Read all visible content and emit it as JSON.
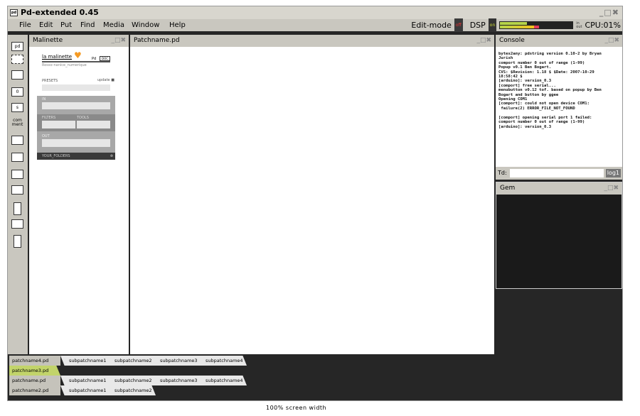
{
  "window": {
    "title": "Pd-extended 0.45",
    "app_icon": "pd-icon"
  },
  "menu": [
    "File",
    "Edit",
    "Put",
    "Find",
    "Media",
    "Window",
    "Help"
  ],
  "status": {
    "edit_mode_label": "Edit-mode",
    "edit_mode_state": "off",
    "dsp_label": "DSP",
    "dsp_state": "on",
    "meter_labels": [
      "in",
      "out"
    ],
    "cpu": "CPU:01%"
  },
  "toolbar": [
    "pd",
    "message-box-dashed",
    "object",
    "number",
    "symbol",
    "comment",
    "bang",
    "toggle",
    "vslider-arrow",
    "hslider",
    "vslider",
    "hradio",
    "vradio"
  ],
  "toolbar_labels": {
    "pd": "pd",
    "number": "0",
    "symbol": "s",
    "comment": "com ment"
  },
  "malinette": {
    "title": "Malinette",
    "logo": "la malinette",
    "logo_sub": "Pd",
    "logo_box": "DOC",
    "subtitle": "Rosso-nanice_numerique",
    "presets": "PRESETS",
    "update": "update",
    "in": "IN",
    "filters": "FILTERS",
    "tools": "TOOLS",
    "out": "OUT",
    "folders": "YOUR_FOLDERS"
  },
  "patch": {
    "title": "Patchname.pd"
  },
  "console": {
    "title": "Console",
    "lines": "bytes2any: pdstring version 0.10-2 by Bryan\nJurish\ncomport number 0 out of range (1-99)\nPopup v0.1 Ben Bogart.\nCVS: $Revision: 1.18 $ $Date: 2007-10-29\n18:58:42 $\n[arduino]: version_0.3\n[comport] free serial...\nmenubutton v0.12 tof. based on popup by Ben\nBogart and button by ggee\nOpening COM1\n[comport]: could not open device COM1:\n failure(2) ERROR_FILE_NOT_FOUND\n\n[comport] opening serial port 1 failed:\ncomport number 0 out of range (1-99)\n[arduino]: version_0.3",
    "input_label": "Td:",
    "input_value": "",
    "log_button": "log1"
  },
  "gem": {
    "title": "Gem"
  },
  "tabs": [
    {
      "main": "patchname4.pd",
      "subs": [
        "subpatchname1",
        "subpatchname2",
        "subpatchname3",
        "subpatchname4"
      ]
    },
    {
      "main": "patchname3.pd",
      "subs": [],
      "active": true
    },
    {
      "main": "patchname.pd",
      "subs": [
        "subpatchname1",
        "subpatchname2",
        "subpatchname3",
        "subpatchname4"
      ]
    },
    {
      "main": "patchname2.pd",
      "subs": [
        "subpatchname1",
        "subpatchname2"
      ]
    }
  ],
  "caption": "100% screen width",
  "colors": {
    "active_tab": "#c2d46a",
    "edit_off": "#e33333",
    "dsp_on": "#ccdd33",
    "logo_heart": "#f59a23"
  }
}
